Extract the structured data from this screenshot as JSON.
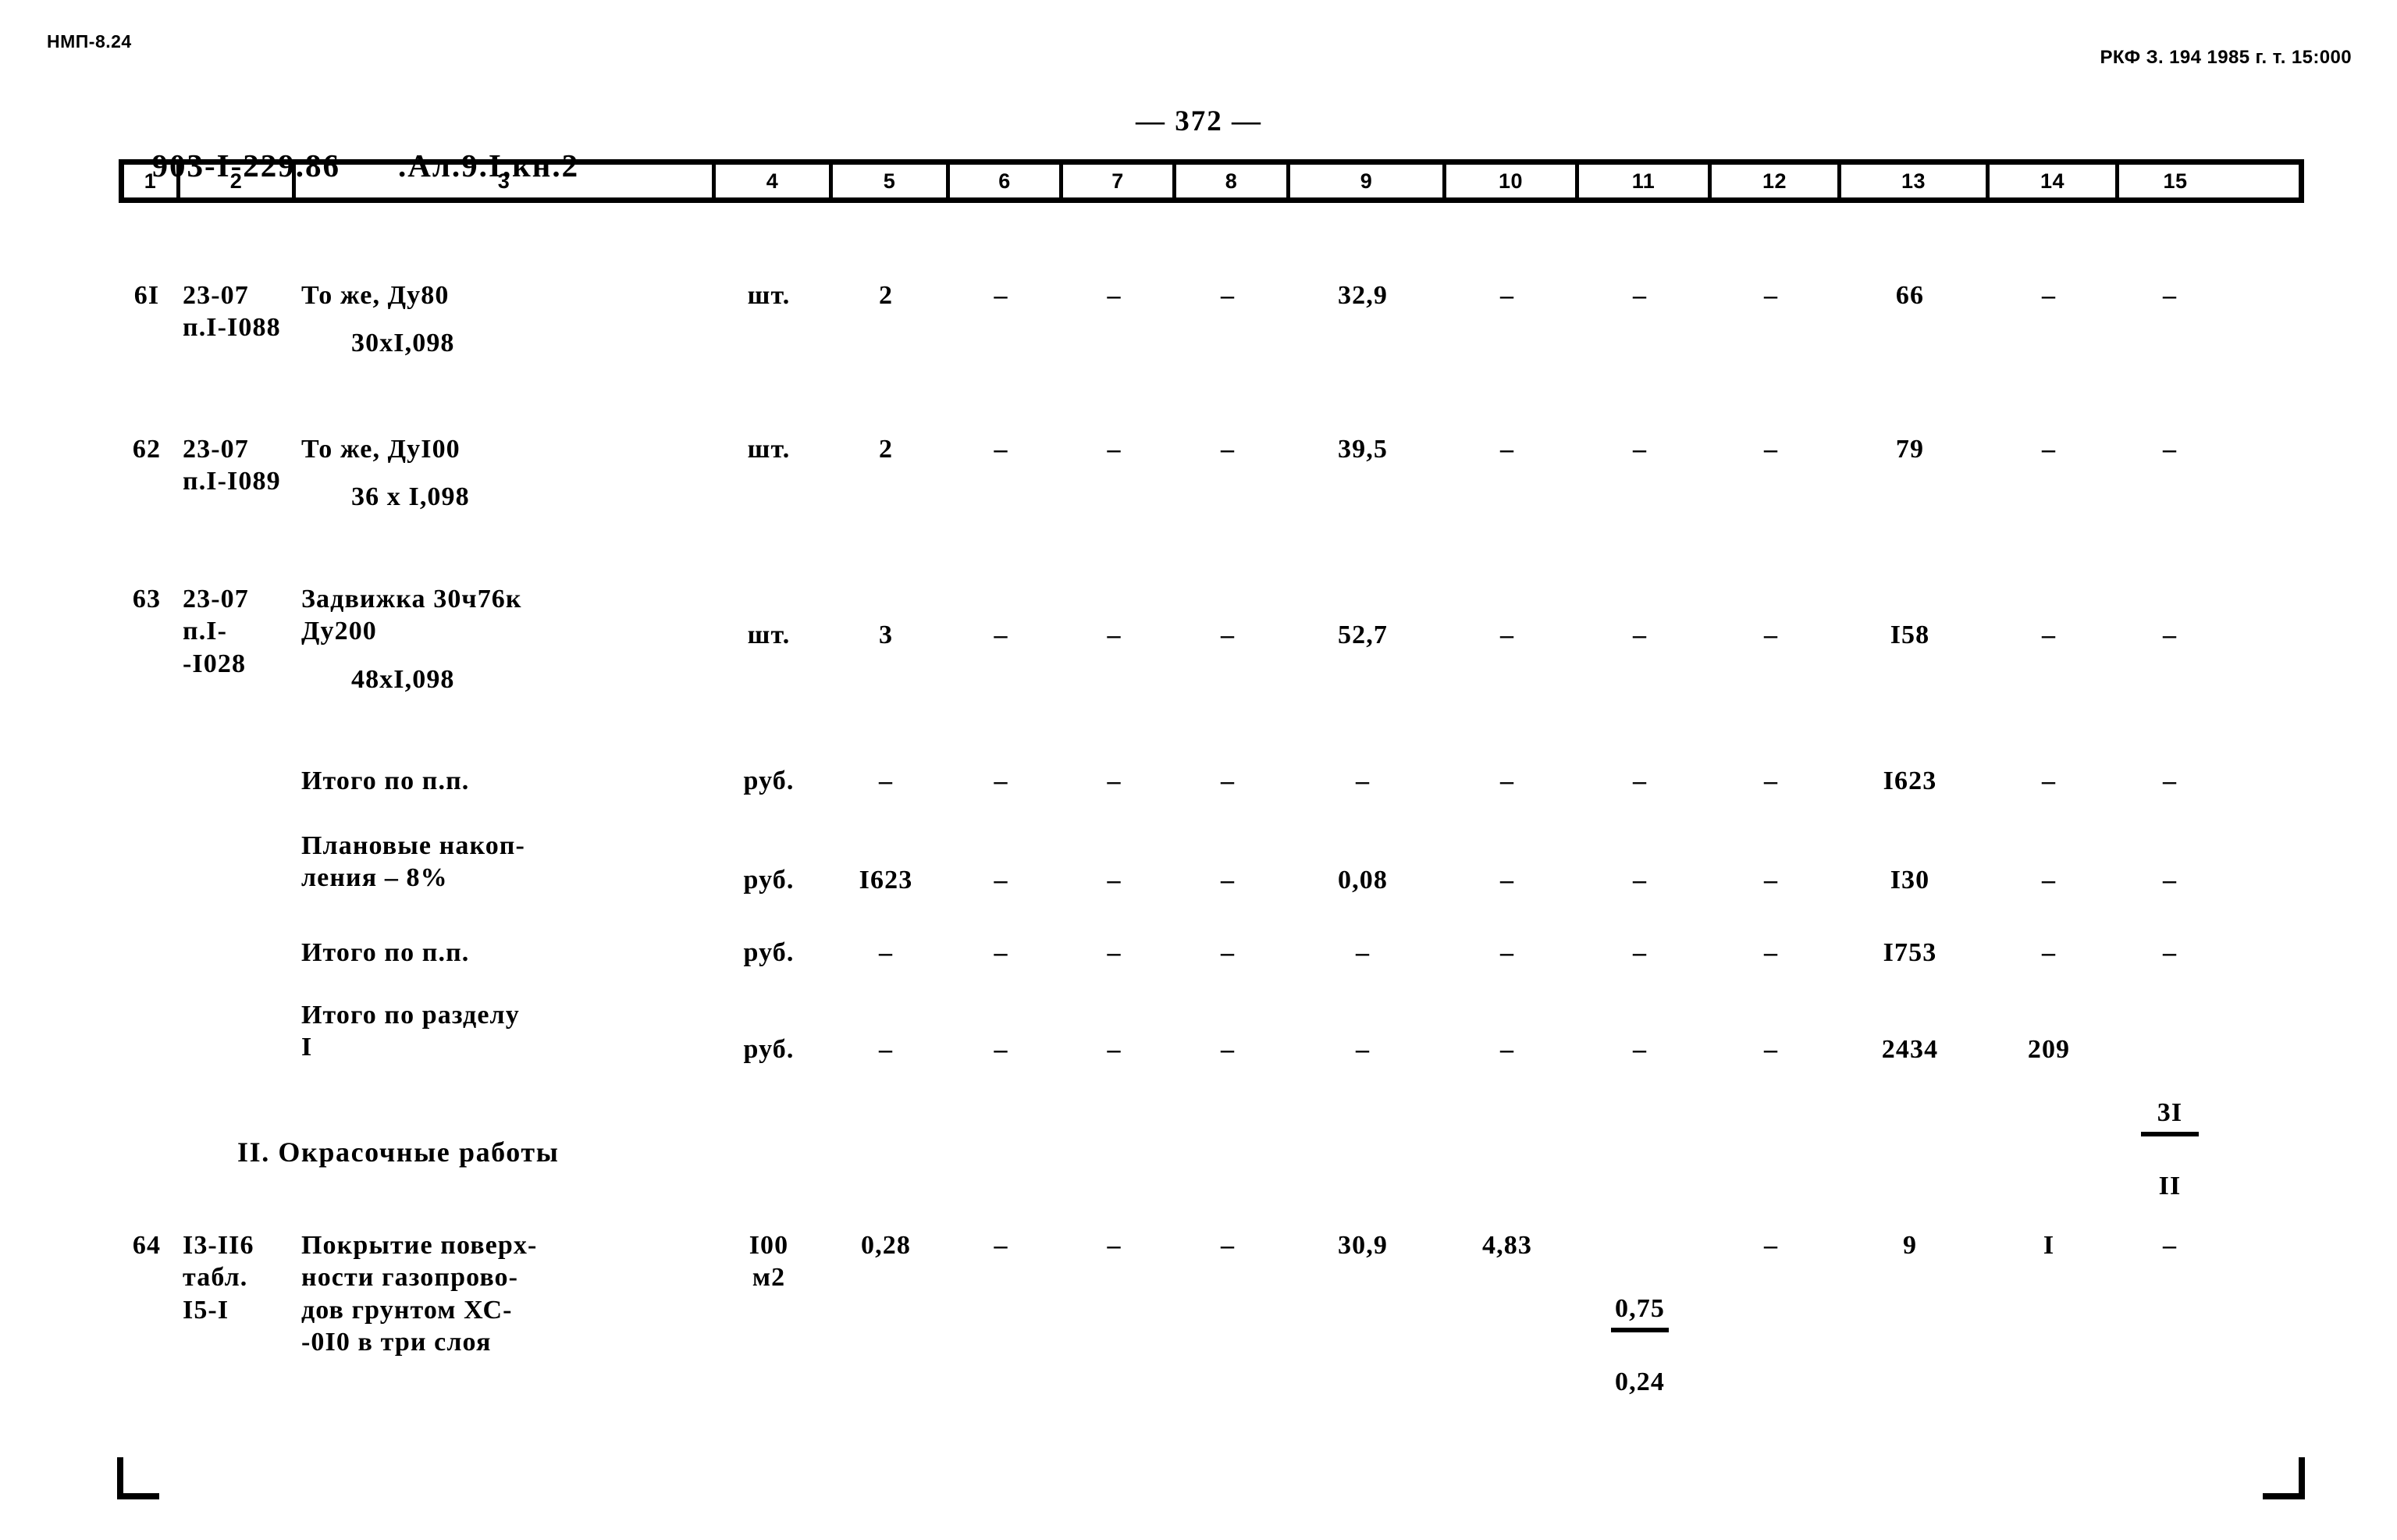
{
  "header": {
    "left_code": "НМП-8.24",
    "right_code": "РКФ З. 194 1985 г. т. 15:000"
  },
  "document": {
    "project_code": "903-I-229.86",
    "album": ".Ал.9.I,кн.2",
    "page_number": "— 372 —"
  },
  "table": {
    "column_numbers": [
      "1",
      "2",
      "3",
      "4",
      "5",
      "6",
      "7",
      "8",
      "9",
      "10",
      "11",
      "12",
      "13",
      "14",
      "15"
    ],
    "rows": [
      {
        "c1": "6I",
        "c2": "23-07\nп.I-I088",
        "c3": "То же, Ду80",
        "c3_sub": "30хI,098",
        "c4": "шт.",
        "c5": "2",
        "c6": "–",
        "c7": "–",
        "c8": "–",
        "c9": "32,9",
        "c10": "–",
        "c11": "–",
        "c12": "–",
        "c13": "66",
        "c14": "–",
        "c15": "–"
      },
      {
        "c1": "62",
        "c2": "23-07\nп.I-I089",
        "c3": "То же, ДуI00",
        "c3_sub": "36 х I,098",
        "c4": "шт.",
        "c5": "2",
        "c6": "–",
        "c7": "–",
        "c8": "–",
        "c9": "39,5",
        "c10": "–",
        "c11": "–",
        "c12": "–",
        "c13": "79",
        "c14": "–",
        "c15": "–"
      },
      {
        "c1": "63",
        "c2": "23-07\nп.I-\n-I028",
        "c3": "Задвижка 30ч76к\nДу200",
        "c3_sub": "48хI,098",
        "c4": "шт.",
        "c5": "3",
        "c6": "–",
        "c7": "–",
        "c8": "–",
        "c9": "52,7",
        "c10": "–",
        "c11": "–",
        "c12": "–",
        "c13": "I58",
        "c14": "–",
        "c15": "–"
      },
      {
        "c1": "",
        "c2": "",
        "c3": "Итого по п.п.",
        "c3_sub": "",
        "c4": "руб.",
        "c5": "–",
        "c6": "–",
        "c7": "–",
        "c8": "–",
        "c9": "–",
        "c10": "–",
        "c11": "–",
        "c12": "–",
        "c13": "I623",
        "c14": "–",
        "c15": "–"
      },
      {
        "c1": "",
        "c2": "",
        "c3": "Плановые накоп-\nления – 8%",
        "c3_sub": "",
        "c4": "руб.",
        "c5": "I623",
        "c6": "–",
        "c7": "–",
        "c8": "–",
        "c9": "0,08",
        "c10": "–",
        "c11": "–",
        "c12": "–",
        "c13": "I30",
        "c14": "–",
        "c15": "–"
      },
      {
        "c1": "",
        "c2": "",
        "c3": "Итого по п.п.",
        "c3_sub": "",
        "c4": "руб.",
        "c5": "–",
        "c6": "–",
        "c7": "–",
        "c8": "–",
        "c9": "–",
        "c10": "–",
        "c11": "–",
        "c12": "–",
        "c13": "I753",
        "c14": "–",
        "c15": "–"
      },
      {
        "c1": "",
        "c2": "",
        "c3": "Итого по разделу\nI",
        "c3_sub": "",
        "c4": "руб.",
        "c5": "–",
        "c6": "–",
        "c7": "–",
        "c8": "–",
        "c9": "–",
        "c10": "–",
        "c11": "–",
        "c12": "–",
        "c13": "2434",
        "c14": "209",
        "c15_frac_top": "3I",
        "c15_frac_bottom": "II"
      },
      {
        "c1": "64",
        "c2": "I3-II6\nтабл.\nI5-I",
        "c3": "Покрытие поверх-\nности газопрово-\nдов грунтом ХС-\n-0I0 в три слоя",
        "c3_sub": "",
        "c4": "I00\nм2",
        "c5": "0,28",
        "c6": "–",
        "c7": "–",
        "c8": "–",
        "c9": "30,9",
        "c10": "4,83",
        "c11_frac_top": "0,75",
        "c11_frac_bottom": "0,24",
        "c12": "–",
        "c13": "9",
        "c14": "I",
        "c15": "–"
      }
    ],
    "section_heading": "II. Окрасочные работы"
  }
}
